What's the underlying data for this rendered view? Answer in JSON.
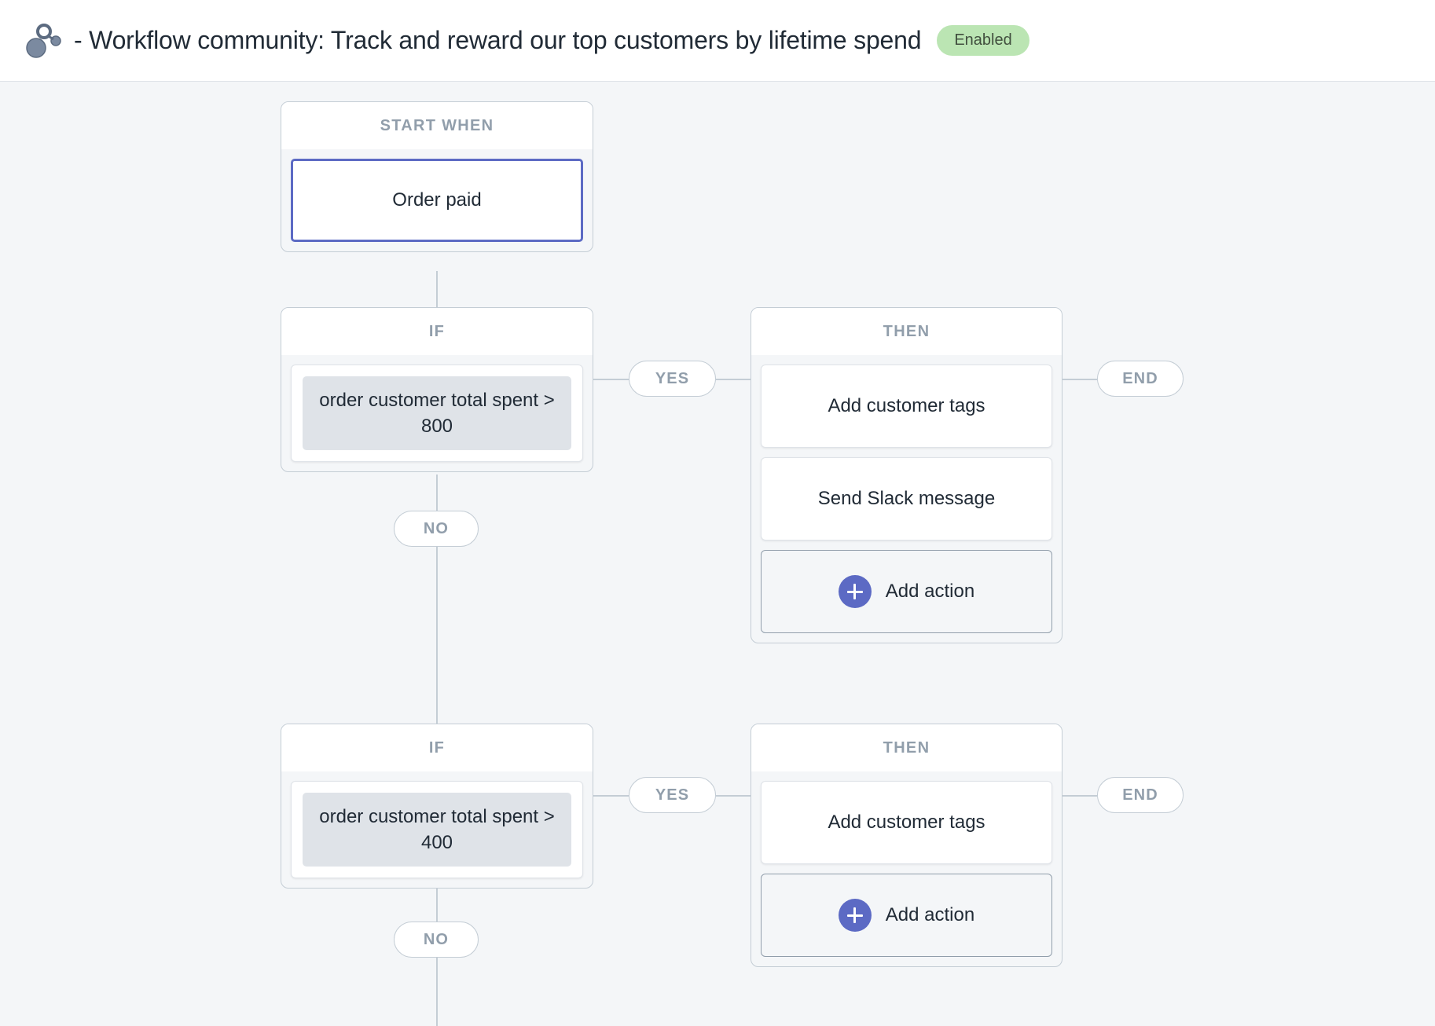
{
  "header": {
    "icon": "workflow-nodes-icon",
    "title": "- Workflow community: Track and reward our top customers by lifetime spend",
    "status": "Enabled",
    "status_color": "#bbe5b3"
  },
  "colors": {
    "accent": "#5c6ac4",
    "canvas_bg": "#f4f6f8",
    "card_border": "#c4cdd5",
    "muted_text": "#919eab",
    "text": "#212b36",
    "chip_bg": "#dfe3e8"
  },
  "flow": {
    "trigger_group": {
      "header": "START WHEN",
      "nodes": [
        {
          "label": "Order paid",
          "selected": true
        }
      ]
    },
    "branches": [
      {
        "if_group": {
          "header": "IF",
          "condition": "order customer total spent > 800"
        },
        "yes_label": "YES",
        "no_label": "NO",
        "end_label": "END",
        "then_group": {
          "header": "THEN",
          "actions": [
            {
              "label": "Add customer tags"
            },
            {
              "label": "Send Slack message"
            }
          ],
          "add_action_label": "Add action",
          "add_action_icon": "plus-icon"
        }
      },
      {
        "if_group": {
          "header": "IF",
          "condition": "order customer total spent > 400"
        },
        "yes_label": "YES",
        "no_label": "NO",
        "end_label": "END",
        "then_group": {
          "header": "THEN",
          "actions": [
            {
              "label": "Add customer tags"
            }
          ],
          "add_action_label": "Add action",
          "add_action_icon": "plus-icon"
        }
      }
    ]
  }
}
